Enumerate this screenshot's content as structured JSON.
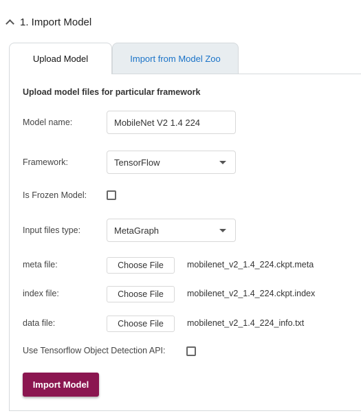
{
  "section": {
    "title": "1. Import Model"
  },
  "tabs": [
    {
      "label": "Upload Model",
      "active": true
    },
    {
      "label": "Import from Model Zoo",
      "active": false
    }
  ],
  "form": {
    "subtitle": "Upload model files for particular framework",
    "model_name": {
      "label": "Model name:",
      "value": "MobileNet V2 1.4 224"
    },
    "framework": {
      "label": "Framework:",
      "value": "TensorFlow"
    },
    "frozen": {
      "label": "Is Frozen Model:",
      "checked": false
    },
    "input_type": {
      "label": "Input files type:",
      "value": "MetaGraph"
    },
    "files": [
      {
        "label": "meta file:",
        "button": "Choose File",
        "filename": "mobilenet_v2_1.4_224.ckpt.meta"
      },
      {
        "label": "index file:",
        "button": "Choose File",
        "filename": "mobilenet_v2_1.4_224.ckpt.index"
      },
      {
        "label": "data file:",
        "button": "Choose File",
        "filename": "mobilenet_v2_1.4_224_info.txt"
      }
    ],
    "od_api": {
      "label": "Use Tensorflow Object Detection API:",
      "checked": false
    },
    "submit": "Import Model"
  },
  "colors": {
    "primary": "#8b1650",
    "link": "#1a73c8"
  }
}
